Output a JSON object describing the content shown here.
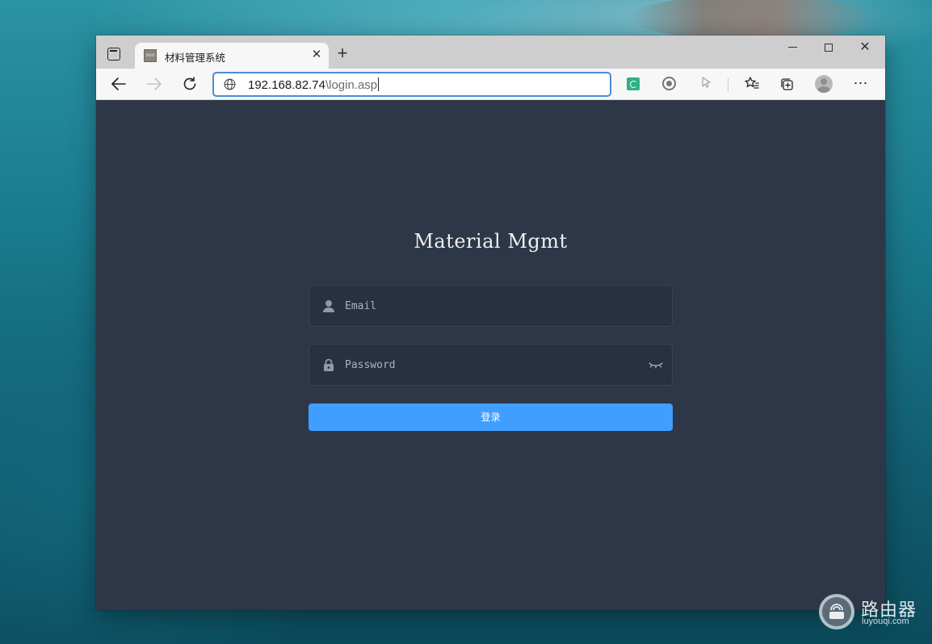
{
  "browser": {
    "tab_title": "材料管理系统",
    "favicon_text": "ooo",
    "url_host": "192.168.82.74",
    "url_path": "\\login.asp",
    "icons": {
      "tab_actions": "tab-actions-icon",
      "tab_close": "close-icon",
      "new_tab": "plus-icon",
      "back": "arrow-left-icon",
      "forward": "arrow-right-icon",
      "reload": "reload-icon",
      "site_info": "globe-icon",
      "extensions": [
        "green-extension-icon",
        "circle-extension-icon",
        "cursor-extension-icon"
      ],
      "favorites": "favorites-icon",
      "collections": "collections-icon",
      "profile": "profile-avatar",
      "more": "more-dots-icon"
    }
  },
  "login": {
    "title": "Material Mgmt",
    "email_placeholder": "Email",
    "password_placeholder": "Password",
    "submit_label": "登录"
  },
  "watermark": {
    "name": "路由器",
    "url": "luyouqi.com"
  },
  "colors": {
    "page_background": "#2e3748",
    "input_background": "#283140",
    "primary_button": "#409eff",
    "address_focus": "#4a8ad8"
  }
}
